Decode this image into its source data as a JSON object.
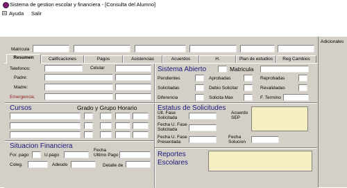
{
  "window": {
    "title": "Sistema de gestion escolar y financiera - [Consulta del Alumno]"
  },
  "menu": {
    "items": [
      "Ayuda",
      "Salir"
    ]
  },
  "header": {
    "matricula_label": "Matricula",
    "adicionales_label": "Adicionales"
  },
  "tabs": [
    {
      "label": "Resumen",
      "active": true
    },
    {
      "label": "Calificaciones"
    },
    {
      "label": "Pagos"
    },
    {
      "label": "Asistencias"
    },
    {
      "label": "Acuerdos"
    },
    {
      "label": "H."
    },
    {
      "label": "Plan de estudios"
    },
    {
      "label": "Reg Cambios"
    }
  ],
  "contact": {
    "telefonos": "Telefonos:",
    "celular": "Celular",
    "padre": "Padre:",
    "madre": "Madre:",
    "emergencia": "Emergencia:"
  },
  "sistema_abierto": {
    "title": "Sistema Abierto",
    "matricula": "Matricula",
    "pendientes": "Pendientes",
    "aprobadas": "Aprobadas",
    "reprobadas": "Reprobadas",
    "solicitadas": "Solicitadas",
    "debio_solicitar": "Debio Solicitar",
    "revalidadas": "Revalidadas",
    "diferencia": "Diferencia",
    "solicita_max": "Solicita Max",
    "f_termino": "F. Termino"
  },
  "cursos": {
    "title": "Cursos",
    "grado_grupo_horario": "Grado y Grupo Horario"
  },
  "estatus": {
    "title": "Estatus de Solicitudes",
    "ult_fase_line1": "Ult. Fase",
    "ult_fase_line2": "Solicitada",
    "acuerdo_line1": "Acuerdo",
    "acuerdo_line2": "SEP",
    "fecha_u_fase_line1": "Fecha U. Fase",
    "fecha_u_fase_solicitada": "Solicitada",
    "fecha_u_fase_presentada": "Presentada",
    "fecha_line1": "Fecha",
    "fecha_solucion": "Solucion"
  },
  "situacion": {
    "title": "Situacion Financiera",
    "for_pago": "For. pago",
    "u_pago": "U.pago",
    "fecha_line1": "Fecha",
    "fecha_line2": "Ultimo Pago",
    "coleg": "Coleg.",
    "adeudo": "Adeudo",
    "detalle": "Detalle de"
  },
  "reportes": {
    "title_line1": "Reportes",
    "title_line2": "Escolares"
  },
  "colors": {
    "window_bg": "#d4d0c8",
    "section_title": "#1a1a7a",
    "emergencia": "#8b1a1a",
    "note_box": "#f4eec2"
  }
}
